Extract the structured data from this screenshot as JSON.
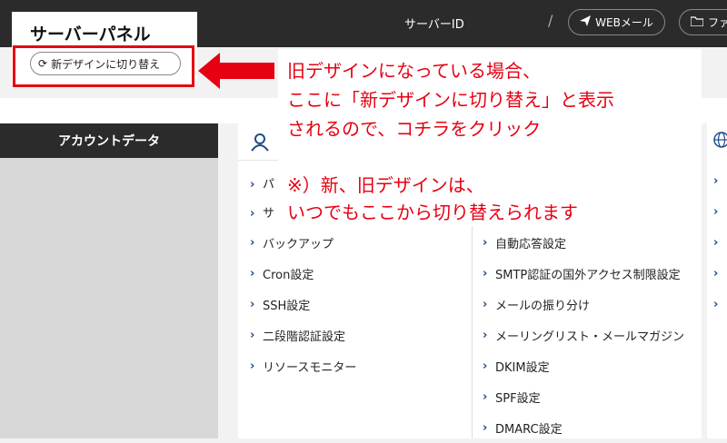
{
  "header": {
    "panel_title": "サーバーパネル",
    "switch_label": "新デザインに切り替え",
    "server_id_label": "サーバーID",
    "separator": "/",
    "webmail_label": "WEBメール",
    "file_label": "ファ"
  },
  "sidebar": {
    "title": "アカウントデータ"
  },
  "menu_left": [
    {
      "label": "バックアップ"
    },
    {
      "label": "Cron設定"
    },
    {
      "label": "SSH設定"
    },
    {
      "label": "二段階認証設定"
    },
    {
      "label": "リソースモニター"
    }
  ],
  "menu_left_partial": [
    "パ",
    "サ"
  ],
  "menu_right": [
    {
      "label": "自動応答設定"
    },
    {
      "label": "SMTP認証の国外アクセス制限設定"
    },
    {
      "label": "メールの振り分け"
    },
    {
      "label": "メーリングリスト・メールマガジン"
    },
    {
      "label": "DKIM設定"
    },
    {
      "label": "SPF設定"
    },
    {
      "label": "DMARC設定"
    }
  ],
  "annotation": {
    "line1": "旧デザインになっている場合、",
    "line2": "ここに「新デザインに切り替え」と表示",
    "line3": "されるので、コチラをクリック",
    "line4": "※）新、旧デザインは、",
    "line5": "いつでもここから切り替えられます"
  },
  "colors": {
    "annotation_red": "#e60012",
    "topbar": "#2b2b2b",
    "link_blue": "#1e4a8c"
  },
  "icons": [
    "refresh-icon",
    "paper-plane-icon",
    "folder-icon",
    "user-icon",
    "globe-icon",
    "chevron-right-icon"
  ]
}
